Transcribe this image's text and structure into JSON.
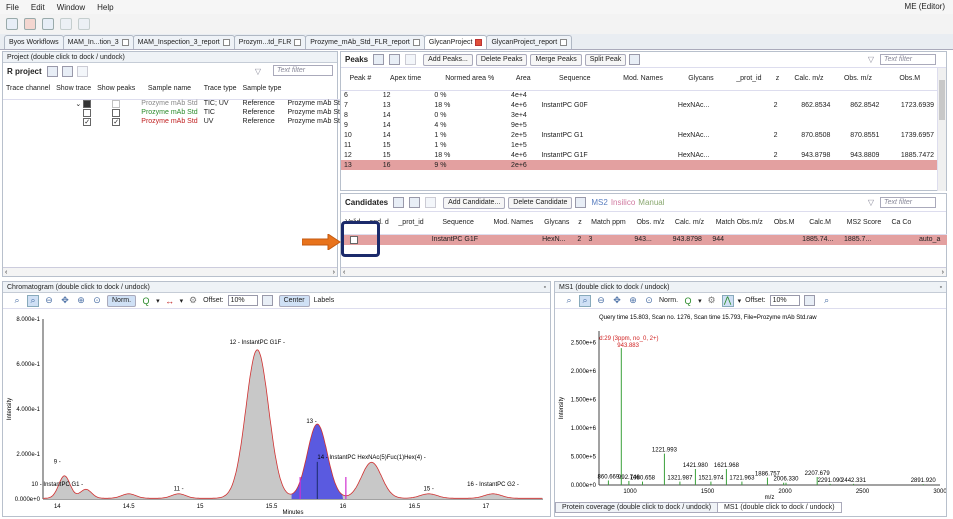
{
  "menu": {
    "items": [
      "File",
      "Edit",
      "Window",
      "Help"
    ],
    "user": "ME (Editor)"
  },
  "tabs": [
    {
      "label": "Byos Workflows"
    },
    {
      "label": "MAM_In...tion_3"
    },
    {
      "label": "MAM_Inspection_3_report"
    },
    {
      "label": "Prozym...td_FLR"
    },
    {
      "label": "Prozyme_mAb_Std_FLR_report"
    },
    {
      "label": "GlycanProject"
    },
    {
      "label": "GlycanProject_report"
    }
  ],
  "project": {
    "title": "Project (double click to dock / undock)",
    "header": "R project",
    "filter": "Text filter",
    "columns": [
      "Trace channel",
      "Show trace",
      "Show peaks",
      "Sample name",
      "Trace type",
      "Sample type",
      ""
    ],
    "rows": [
      {
        "name": "Prozyme mAb Std",
        "type": "TIC; UV",
        "stype": "Reference",
        "file": "Prozyme mAb Std.ra",
        "color": "#888"
      },
      {
        "name": "Prozyme mAb Std",
        "type": "TIC",
        "stype": "Reference",
        "file": "Prozyme mAb Std.ra",
        "color": "#2a8a2a"
      },
      {
        "name": "Prozyme mAb Std",
        "type": "UV",
        "stype": "Reference",
        "file": "Prozyme mAb Std_L",
        "color": "#c02020"
      }
    ]
  },
  "peaks": {
    "title": "Peaks",
    "filter": "Text filter",
    "buttons": [
      "Add Peaks...",
      "Delete Peaks",
      "Merge Peaks",
      "Split Peak"
    ],
    "columns": [
      "Peak #",
      "Apex time",
      "Normed area %",
      "Area",
      "Sequence",
      "Mod. Names",
      "Glycans",
      "_prot_id",
      "z",
      "Calc. m/z",
      "Obs. m/z",
      "Obs.M"
    ],
    "rows": [
      [
        "6",
        "12",
        "0 %",
        "4e+4",
        "",
        "",
        "",
        "",
        "",
        "",
        "",
        ""
      ],
      [
        "7",
        "13",
        "18 %",
        "4e+6",
        "InstantPC G0F",
        "",
        "HexNAc...",
        "",
        "2",
        "862.8534",
        "862.8542",
        "1723.6939"
      ],
      [
        "8",
        "14",
        "0 %",
        "3e+4",
        "",
        "",
        "",
        "",
        "",
        "",
        "",
        ""
      ],
      [
        "9",
        "14",
        "4 %",
        "9e+5",
        "",
        "",
        "",
        "",
        "",
        "",
        "",
        ""
      ],
      [
        "10",
        "14",
        "1 %",
        "2e+5",
        "InstantPC G1",
        "",
        "HexNAc...",
        "",
        "2",
        "870.8508",
        "870.8551",
        "1739.6957"
      ],
      [
        "11",
        "15",
        "1 %",
        "1e+5",
        "",
        "",
        "",
        "",
        "",
        "",
        "",
        ""
      ],
      [
        "12",
        "15",
        "18 %",
        "4e+6",
        "InstantPC G1F",
        "",
        "HexNAc...",
        "",
        "2",
        "943.8798",
        "943.8809",
        "1885.7472"
      ],
      [
        "13",
        "16",
        "9 %",
        "2e+6",
        "",
        "",
        "",
        "",
        "",
        "",
        "",
        ""
      ]
    ]
  },
  "candidates": {
    "title": "Candidates",
    "filter": "Text filter",
    "buttons": [
      "Add Candidate...",
      "Delete Candidate"
    ],
    "modes": [
      "MS2",
      "Insilico",
      "Manual"
    ],
    "columns": [
      "Valid",
      "and. d",
      "_prot_id",
      "Sequence",
      "Mod. Names",
      "Glycans",
      "z",
      "Match ppm",
      "Obs. m/z",
      "Calc. m/z",
      "Match Obs.m/z",
      "Obs.M",
      "Calc.M",
      "MS2 Score",
      "Ca Co"
    ],
    "row": [
      "",
      "",
      "",
      "InstantPC G1F",
      "",
      "HexN...",
      "2",
      "3",
      "943...",
      "943.8798",
      "944",
      "",
      "1885.74...",
      "1885.7...",
      "",
      "auto_a"
    ]
  },
  "chrom": {
    "title": "Chromatogram (double click to dock / undock)",
    "offset_label": "Offset:",
    "offset": "10%",
    "norm": "Norm.",
    "center": "Center",
    "labels": "Labels",
    "xlabel": "Minutes",
    "ylabel": "Intensity"
  },
  "chart_data": [
    {
      "type": "area",
      "xlabel": "Minutes",
      "ylabel": "Intensity",
      "x_ticks": [
        "14",
        "14.5",
        "15",
        "15.5",
        "16",
        "16.5",
        "17"
      ],
      "y_ticks": [
        "0.000e+0",
        "2.000e-1",
        "4.000e-1",
        "6.000e-1",
        "8.000e-1"
      ],
      "xlim": [
        13.9,
        17.4
      ],
      "ylim": [
        0,
        0.8
      ],
      "peaks": [
        {
          "x": 14.05,
          "h": 0.1,
          "w": 0.04
        },
        {
          "x": 14.2,
          "h": 0.04,
          "w": 0.04
        },
        {
          "x": 14.5,
          "h": 0.02,
          "w": 0.05
        },
        {
          "x": 14.85,
          "h": 0.02,
          "w": 0.05
        },
        {
          "x": 15.4,
          "h": 0.66,
          "w": 0.08
        },
        {
          "x": 15.82,
          "h": 0.33,
          "w": 0.07
        },
        {
          "x": 16.2,
          "h": 0.16,
          "w": 0.07
        },
        {
          "x": 16.6,
          "h": 0.02,
          "w": 0.06
        },
        {
          "x": 17.05,
          "h": 0.02,
          "w": 0.06
        }
      ],
      "annotations": [
        {
          "x": 14.0,
          "y": 0.15,
          "text": "9 -"
        },
        {
          "x": 14.0,
          "y": 0.05,
          "text": "10 - InstantPC G1 -"
        },
        {
          "x": 14.85,
          "y": 0.03,
          "text": "11 -"
        },
        {
          "x": 15.4,
          "y": 0.68,
          "text": "12 - InstantPC G1F -"
        },
        {
          "x": 15.78,
          "y": 0.33,
          "text": "13 -"
        },
        {
          "x": 16.2,
          "y": 0.17,
          "text": "14 - InstantPC HexNAc(5)Fuc(1)Hex(4) -"
        },
        {
          "x": 16.6,
          "y": 0.03,
          "text": "15 -"
        },
        {
          "x": 17.05,
          "y": 0.05,
          "text": "16 - InstantPC G2 -"
        }
      ]
    },
    {
      "type": "bar",
      "xlabel": "m/z",
      "ylabel": "Intensity",
      "x_ticks": [
        "1000",
        "1500",
        "2000",
        "2500",
        "3000"
      ],
      "y_ticks": [
        "0.000e+0",
        "5.000e+5",
        "1.000e+6",
        "1.500e+6",
        "2.000e+6",
        "2.500e+6"
      ],
      "xlim": [
        800,
        3000
      ],
      "ylim": [
        0,
        2700000
      ],
      "peaks": [
        {
          "x": 943.883,
          "y": 2400000
        },
        {
          "x": 860.669,
          "y": 80000
        },
        {
          "x": 992.746,
          "y": 70000
        },
        {
          "x": 1080.6,
          "y": 60000
        },
        {
          "x": 1221.993,
          "y": 550000
        },
        {
          "x": 1321.987,
          "y": 60000
        },
        {
          "x": 1421.98,
          "y": 280000
        },
        {
          "x": 1521.974,
          "y": 60000
        },
        {
          "x": 1621.968,
          "y": 280000
        },
        {
          "x": 1721.963,
          "y": 60000
        },
        {
          "x": 1886.757,
          "y": 130000
        },
        {
          "x": 1991.3,
          "y": 40000
        },
        {
          "x": 2006.33,
          "y": 40000
        },
        {
          "x": 2207.679,
          "y": 140000
        },
        {
          "x": 2291.09,
          "y": 20000
        },
        {
          "x": 2442.331,
          "y": 20000
        },
        {
          "x": 2891.92,
          "y": 15000
        }
      ],
      "annotations": [
        {
          "x": 860.669,
          "text": "860.669"
        },
        {
          "x": 1080.6,
          "text": "1080.658"
        },
        {
          "x": 992.746,
          "text": "992.746"
        },
        {
          "x": 1221.993,
          "text": "1221.993"
        },
        {
          "x": 1421.98,
          "text": "1421.980"
        },
        {
          "x": 1321.987,
          "text": "1321.987"
        },
        {
          "x": 1621.968,
          "text": "1621.968"
        },
        {
          "x": 1521.974,
          "text": "1521.974"
        },
        {
          "x": 1721.963,
          "text": "1721.963"
        },
        {
          "x": 1886.757,
          "text": "1886.757"
        },
        {
          "x": 2006.33,
          "text": "2006.330"
        },
        {
          "x": 2207.679,
          "text": "2207.679"
        },
        {
          "x": 2291.09,
          "text": "2291.090"
        },
        {
          "x": 2442.331,
          "text": "2442.331"
        },
        {
          "x": 2891.92,
          "text": "2891.920"
        }
      ]
    }
  ],
  "ms1": {
    "title": "MS1 (double click to dock / undock)",
    "offset_label": "Offset:",
    "offset": "10%",
    "norm": "Norm.",
    "query": "Query time 15.803, Scan no. 1276, Scan time 15.793, File=Prozyme mAb Std.raw",
    "peak_label": "d:29 (3ppm, no_0, 2+)",
    "peak_mz": "943.883",
    "bottom_tabs": [
      "Protein coverage (double click to dock / undock)",
      "MS1 (double click to dock / undock)"
    ]
  }
}
